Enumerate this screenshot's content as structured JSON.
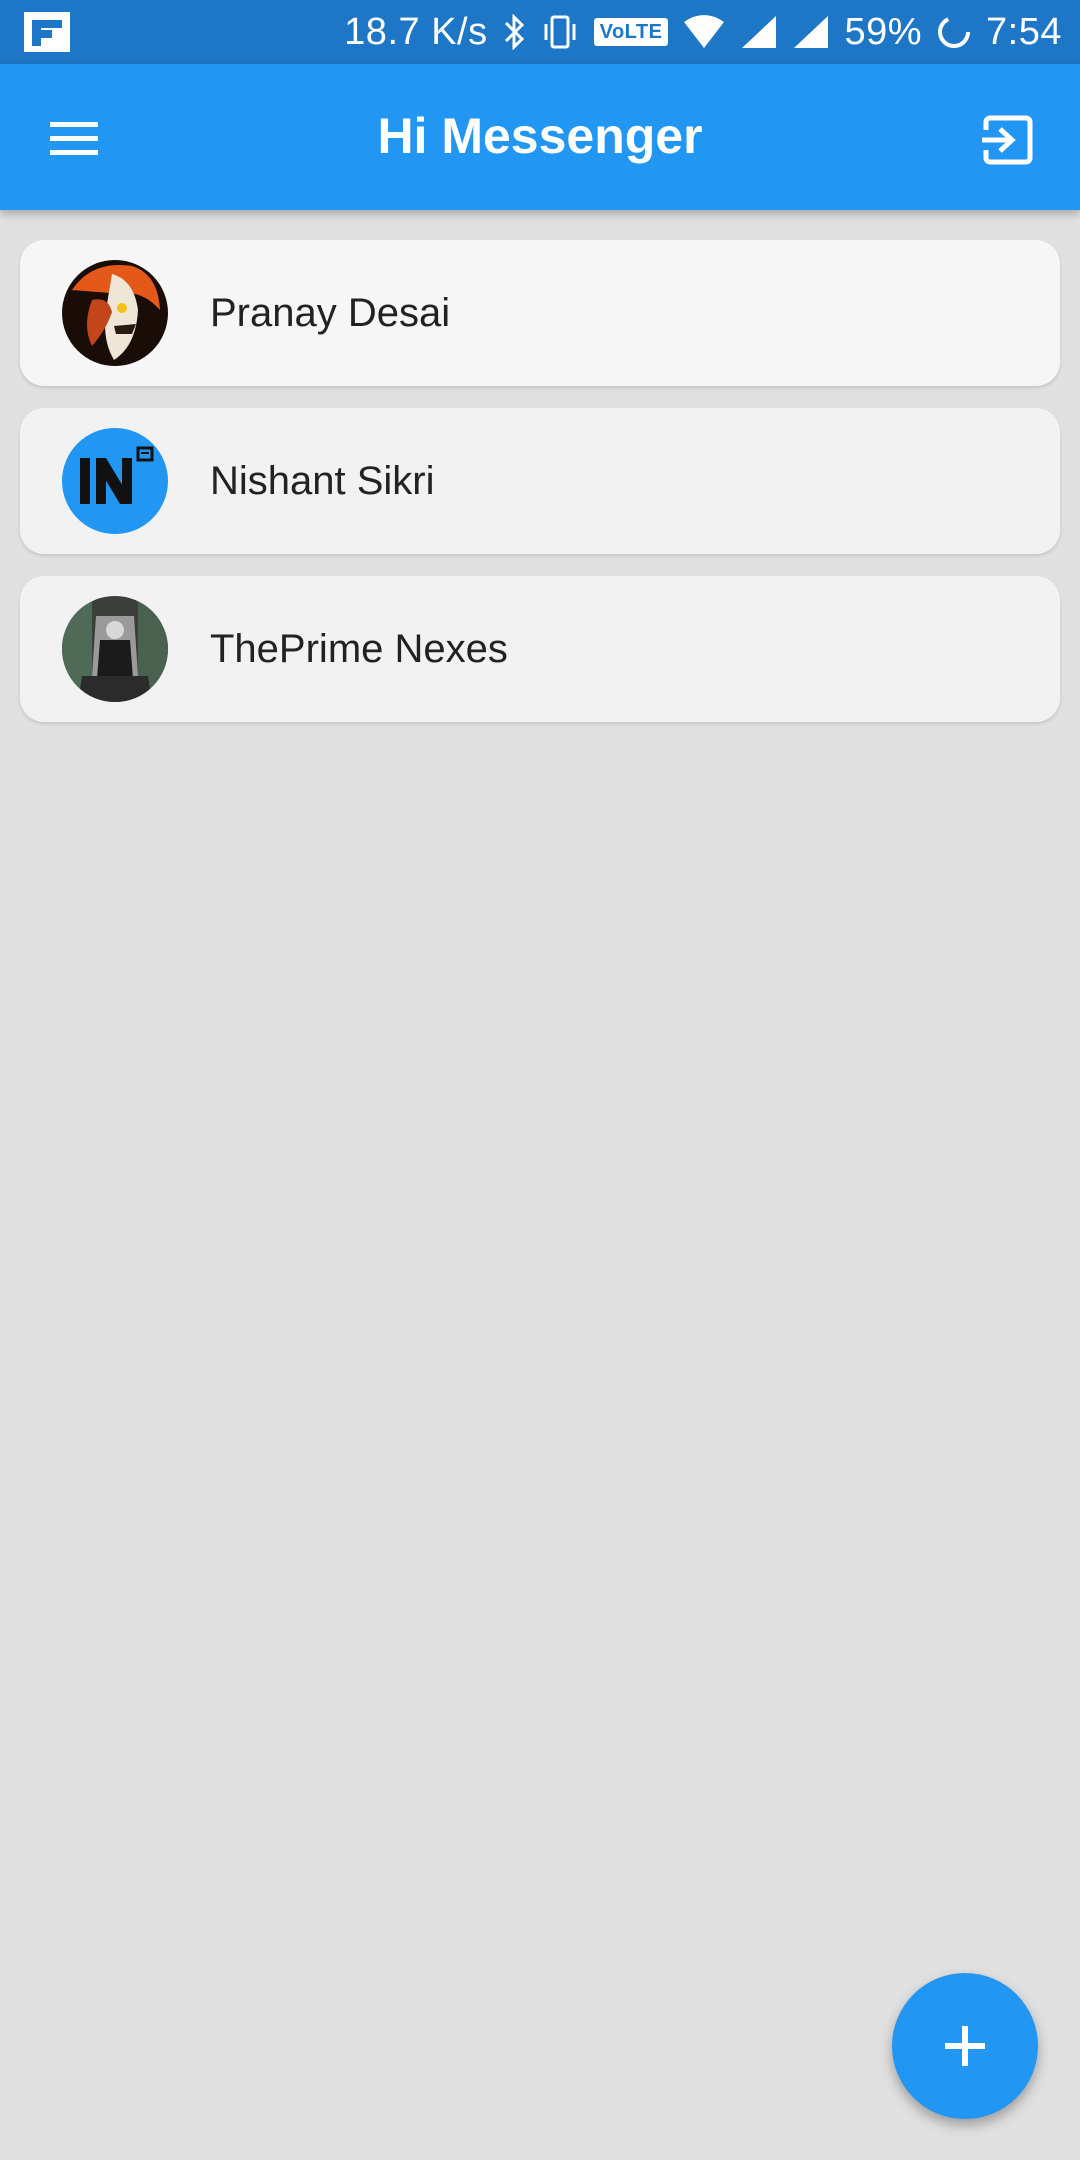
{
  "status_bar": {
    "net_speed": "18.7 K/s",
    "volte": "VoLTE",
    "battery": "59%",
    "time": "7:54"
  },
  "app_bar": {
    "title": "Hi Messenger",
    "menu_icon": "hamburger-menu-icon",
    "exit_icon": "logout-icon"
  },
  "contacts": [
    {
      "name": "Pranay Desai"
    },
    {
      "name": "Nishant Sikri"
    },
    {
      "name": "ThePrime Nexes"
    }
  ],
  "fab": {
    "icon": "plus-icon"
  },
  "colors": {
    "status_bar": "#1e76c6",
    "app_bar": "#2196f3",
    "background": "#e0e0e0",
    "accent": "#2196f3"
  }
}
